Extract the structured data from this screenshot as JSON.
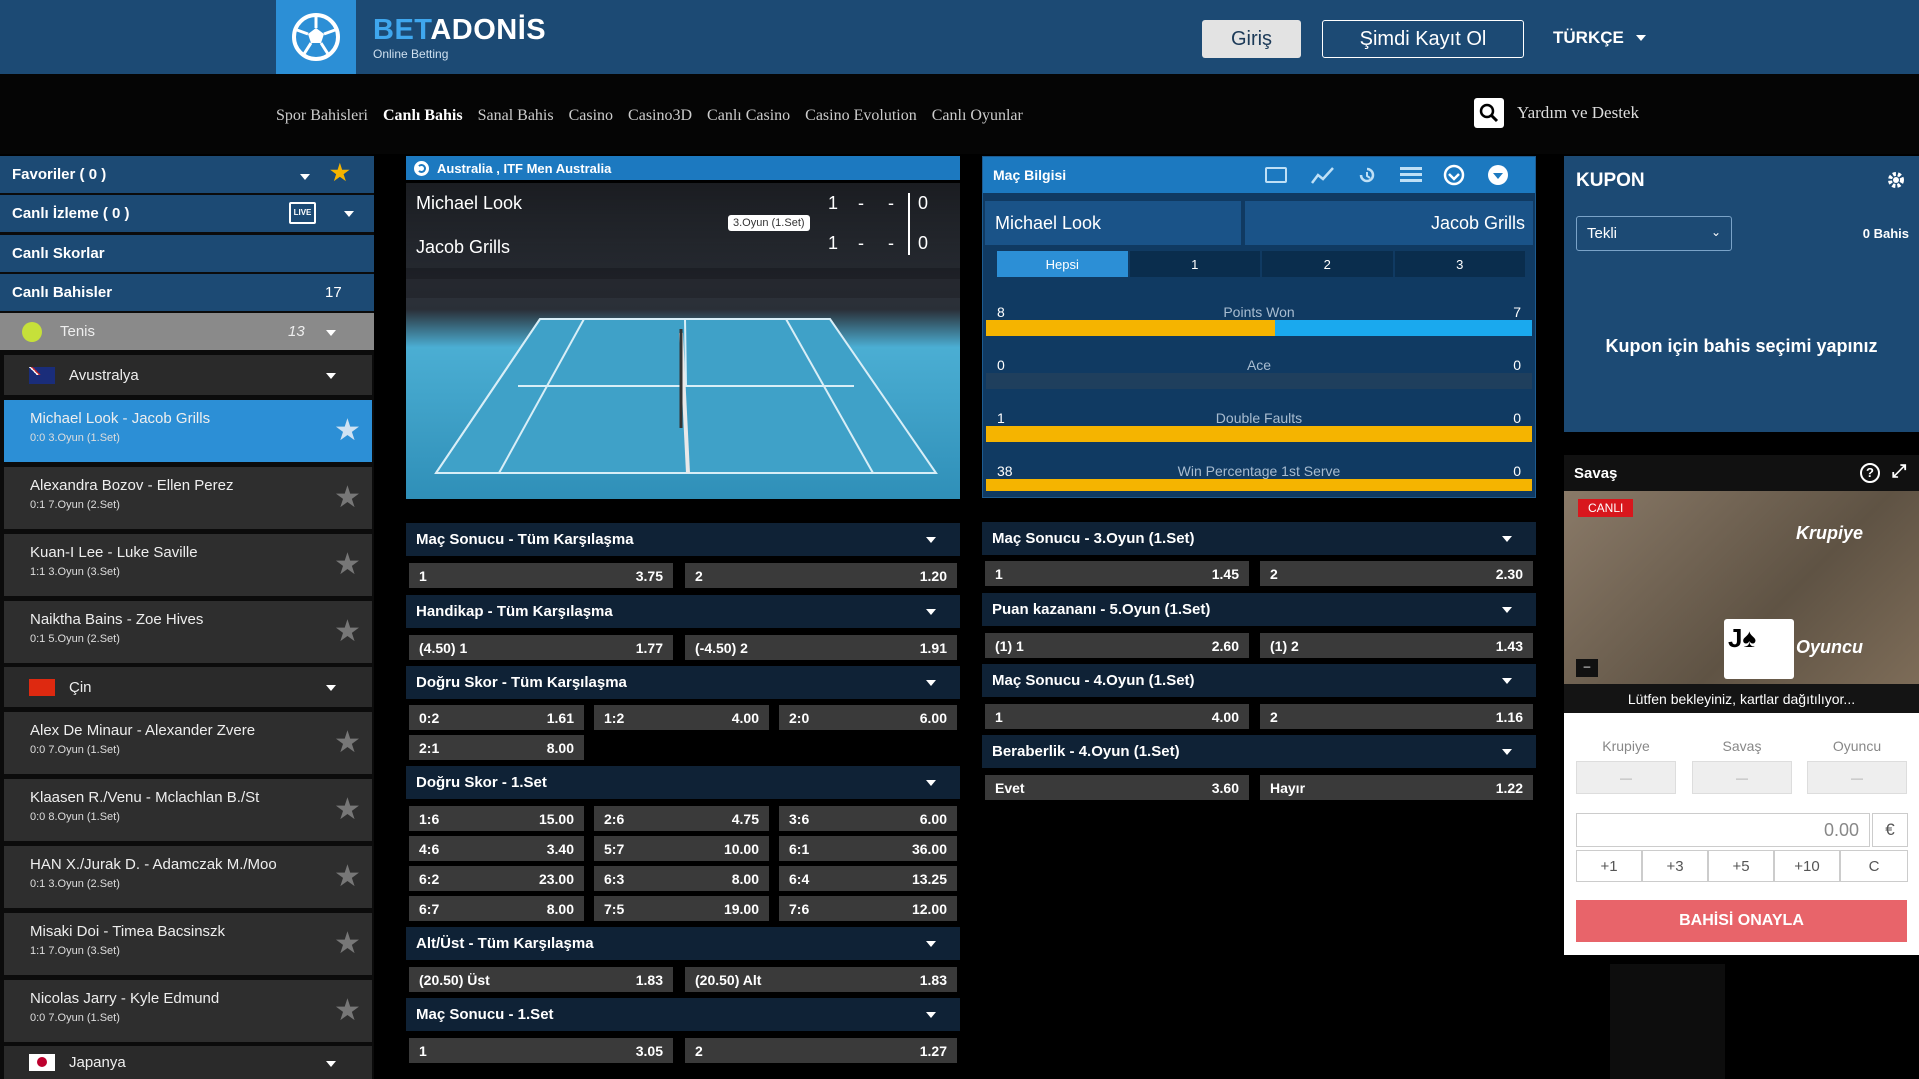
{
  "brand": {
    "name_a": "BET",
    "name_b": "ADONİS",
    "tagline": "Online Betting"
  },
  "header": {
    "login": "Giriş",
    "signup": "Şimdi Kayıt Ol",
    "language": "TÜRKÇE"
  },
  "nav": {
    "items": [
      "Spor Bahisleri",
      "Canlı Bahis",
      "Sanal Bahis",
      "Casino",
      "Casino3D",
      "Canlı Casino",
      "Casino Evolution",
      "Canlı Oyunlar"
    ],
    "active": "Canlı Bahis",
    "help": "Yardım ve Destek"
  },
  "sidebar": {
    "favorites": "Favoriler ( 0 )",
    "live_watch": "Canlı İzleme ( 0 )",
    "live_scores": "Canlı Skorlar",
    "live_bets": "Canlı Bahisler",
    "live_bets_count": "17",
    "sport": "Tenis",
    "sport_count": "13",
    "country_au": "Avustralya",
    "country_cn": "Çin",
    "country_jp": "Japanya",
    "matches": [
      {
        "name": "Michael Look - Jacob Grills",
        "info": "0:0  3.Oyun (1.Set)"
      },
      {
        "name": "Alexandra Bozov - Ellen Perez",
        "info": "0:1  7.Oyun (2.Set)"
      },
      {
        "name": "Kuan-I Lee - Luke Saville",
        "info": "1:1  3.Oyun (3.Set)"
      },
      {
        "name": "Naiktha Bains - Zoe Hives",
        "info": "0:1  5.Oyun (2.Set)"
      },
      {
        "name": "Alex De Minaur - Alexander Zvere",
        "info": "0:0  7.Oyun (1.Set)"
      },
      {
        "name": "Klaasen R./Venu - Mclachlan B./St",
        "info": "0:0  8.Oyun (1.Set)"
      },
      {
        "name": "HAN X./Jurak D. - Adamczak M./Moo",
        "info": "0:1  3.Oyun (2.Set)"
      },
      {
        "name": "Misaki Doi - Timea Bacsinszk",
        "info": "1:1  7.Oyun (3.Set)"
      },
      {
        "name": "Nicolas Jarry - Kyle Edmund",
        "info": "0:0  7.Oyun (1.Set)"
      }
    ]
  },
  "live": {
    "title": "Australia , ITF Men Australia",
    "player1": "Michael Look",
    "player2": "Jacob Grills",
    "p1_sets": "1",
    "p1_pts": "0",
    "p2_sets": "1",
    "p2_pts": "0",
    "dash": "-",
    "tooltip": "3.Oyun (1.Set)"
  },
  "markets_left": [
    {
      "title": "Maç Sonucu - Tüm Karşılaşma",
      "odds": [
        [
          "1",
          "3.75"
        ],
        [
          "2",
          "1.20"
        ]
      ]
    },
    {
      "title": "Handikap - Tüm Karşılaşma",
      "odds": [
        [
          "(4.50) 1",
          "1.77"
        ],
        [
          "(-4.50) 2",
          "1.91"
        ]
      ]
    },
    {
      "title": "Doğru Skor - Tüm Karşılaşma",
      "odds": [
        [
          "0:2",
          "1.61"
        ],
        [
          "1:2",
          "4.00"
        ],
        [
          "2:0",
          "6.00"
        ],
        [
          "2:1",
          "8.00"
        ]
      ]
    },
    {
      "title": "Doğru Skor - 1.Set",
      "odds": [
        [
          "1:6",
          "15.00"
        ],
        [
          "2:6",
          "4.75"
        ],
        [
          "3:6",
          "6.00"
        ],
        [
          "4:6",
          "3.40"
        ],
        [
          "5:7",
          "10.00"
        ],
        [
          "6:1",
          "36.00"
        ],
        [
          "6:2",
          "23.00"
        ],
        [
          "6:3",
          "8.00"
        ],
        [
          "6:4",
          "13.25"
        ],
        [
          "6:7",
          "8.00"
        ],
        [
          "7:5",
          "19.00"
        ],
        [
          "7:6",
          "12.00"
        ]
      ]
    },
    {
      "title": "Alt/Üst - Tüm Karşılaşma",
      "odds": [
        [
          "(20.50) Üst",
          "1.83"
        ],
        [
          "(20.50) Alt",
          "1.83"
        ]
      ]
    },
    {
      "title": "Maç Sonucu - 1.Set",
      "odds": [
        [
          "1",
          "3.05"
        ],
        [
          "2",
          "1.27"
        ]
      ]
    }
  ],
  "markets_right": [
    {
      "title": "Maç Sonucu - 3.Oyun (1.Set)",
      "odds": [
        [
          "1",
          "1.45"
        ],
        [
          "2",
          "2.30"
        ]
      ]
    },
    {
      "title": "Puan kazananı - 5.Oyun (1.Set)",
      "odds": [
        [
          "(1) 1",
          "2.60"
        ],
        [
          "(1) 2",
          "1.43"
        ]
      ]
    },
    {
      "title": "Maç Sonucu - 4.Oyun (1.Set)",
      "odds": [
        [
          "1",
          "4.00"
        ],
        [
          "2",
          "1.16"
        ]
      ]
    },
    {
      "title": "Beraberlik - 4.Oyun (1.Set)",
      "odds": [
        [
          "Evet",
          "3.60"
        ],
        [
          "Hayır",
          "1.22"
        ]
      ]
    }
  ],
  "match_info": {
    "title": "Maç Bilgisi",
    "player1": "Michael Look",
    "player2": "Jacob Grills",
    "tabs": [
      "Hepsi",
      "1",
      "2",
      "3"
    ],
    "stats": [
      {
        "label": "Points Won",
        "left": "8",
        "right": "7",
        "share": 0.53
      },
      {
        "label": "Ace",
        "left": "0",
        "right": "0",
        "share": null
      },
      {
        "label": "Double Faults",
        "left": "1",
        "right": "0",
        "share": 1.0
      },
      {
        "label": "Win Percentage 1st Serve",
        "left": "38",
        "right": "0",
        "share": 1.0
      }
    ]
  },
  "coupon": {
    "title": "KUPON",
    "type": "Tekli",
    "count": "0 Bahis",
    "message": "Kupon için bahis seçimi yapınız"
  },
  "game": {
    "title": "Savaş",
    "live": "CANLI",
    "dealer": "Krupiye",
    "player": "Oyuncu",
    "message": "Lütfen bekleyiniz, kartlar dağıtılıyor...",
    "cols": [
      "Krupiye",
      "Savaş",
      "Oyuncu"
    ],
    "box_text": "—",
    "amount": "0.00",
    "currency": "€",
    "chips": [
      "+1",
      "+3",
      "+5",
      "+10",
      "C"
    ],
    "confirm": "BAHİSİ ONAYLA"
  }
}
